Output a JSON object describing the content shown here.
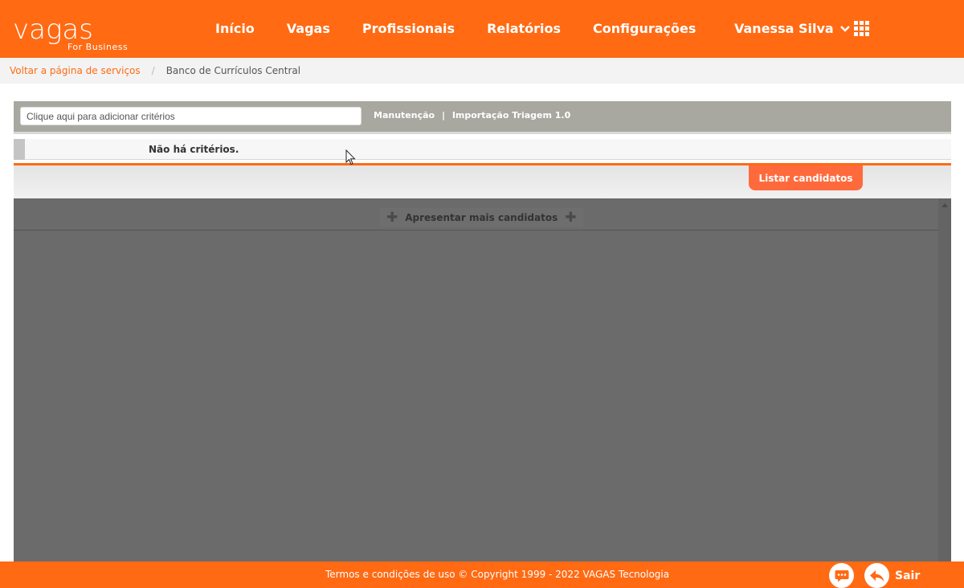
{
  "brand": {
    "word": "vagas",
    "sub": "For Business",
    "accent": "#ff6a13"
  },
  "nav": {
    "items": [
      {
        "label": "Início"
      },
      {
        "label": "Vagas"
      },
      {
        "label": "Profissionais"
      },
      {
        "label": "Relatórios"
      },
      {
        "label": "Configurações"
      }
    ]
  },
  "user": {
    "name": "Vanessa Silva"
  },
  "breadcrumb": {
    "back_label": "Voltar a página de serviços",
    "separator": "/",
    "current": "Banco de Currículos Central"
  },
  "search": {
    "placeholder": "Clique aqui para adicionar critérios",
    "value": "",
    "link1": "Manutenção",
    "link_separator": "|",
    "link2": "Importação Triagem 1.0"
  },
  "criteria": {
    "empty_text": "Não há critérios."
  },
  "actions": {
    "list_button": "Listar candidatos",
    "more_label": "Apresentar mais candidatos",
    "plus_glyph": "✚"
  },
  "footer": {
    "text": "Termos e condições de uso © Copyright 1999 - 2022 VAGAS Tecnologia",
    "exit_label": "Sair"
  }
}
